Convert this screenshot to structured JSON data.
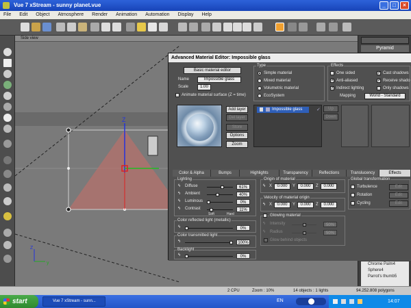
{
  "app": {
    "title": "Vue 7 xStream - sunny planet.vue",
    "win_min": "_",
    "win_max": "□",
    "win_close": "×"
  },
  "menu": [
    "File",
    "Edit",
    "Object",
    "Atmosphere",
    "Render",
    "Animation",
    "Automation",
    "Display",
    "Help"
  ],
  "viewport": {
    "label": "Side view",
    "axis_z": "Z",
    "axis_y": "y"
  },
  "right_panel": {
    "tab": "Pyramid",
    "objects": [
      "Chrome Palm4",
      "Sphere4",
      "Parrot's thumb5"
    ]
  },
  "dialog": {
    "title": "Advanced Material Editor: Impossible glass",
    "basic_editor_button": "Basic material editor",
    "name_label": "Name",
    "name_value": "Impossible glass",
    "scale_label": "Scale",
    "scale_value": "1.00",
    "animate_label": "Animate material surface (Z = time)",
    "buttons": {
      "add_layer": "Add layer",
      "del_layer": "Del layer",
      "store": "Store",
      "options": "Options",
      "zoom": "Zoom",
      "up": "Up",
      "down": "Down"
    },
    "type": {
      "title": "Type",
      "options": [
        "Simple material",
        "Mixed material",
        "Volumetric material",
        "EcoSystem"
      ],
      "selected_index": 0
    },
    "effects": {
      "title": "Effects",
      "left": [
        {
          "label": "One sided",
          "checked": false
        },
        {
          "label": "Anti-aliased",
          "checked": true
        },
        {
          "label": "Indirect lighting",
          "checked": true
        }
      ],
      "right": [
        {
          "label": "Cast shadows",
          "checked": true
        },
        {
          "label": "Receive shado",
          "checked": true
        },
        {
          "label": "Only shadows",
          "checked": false
        }
      ],
      "mapping_label": "Mapping",
      "mapping_value": "World - Standard"
    },
    "layer_name": "Impossible glass",
    "tabs": [
      "Color & Alpha",
      "Bumps",
      "Highlights",
      "Transparency",
      "Reflections",
      "Translucency",
      "Effects"
    ],
    "active_tab": "Effects",
    "lighting": {
      "title": "Lighting",
      "rows": [
        {
          "label": "Diffuse",
          "value": "61%",
          "fraction": 0.61
        },
        {
          "label": "Ambient",
          "value": "40%",
          "fraction": 0.4
        },
        {
          "label": "Luminous",
          "value": "0%",
          "fraction": 0.0
        },
        {
          "label": "Contrast",
          "value": "11%",
          "fraction": 0.11
        }
      ],
      "soft": "Soft",
      "hard": "Hard"
    },
    "color_reflected": {
      "title": "Color reflected light (metallic)",
      "value": "0%"
    },
    "color_transmitted": {
      "title": "Color transmitted light",
      "value": "100%"
    },
    "backlight": {
      "title": "Backlight",
      "value": "0%"
    },
    "origin": {
      "title": "Origin of material",
      "x": "0.000",
      "y": "0.000",
      "z": "0.000"
    },
    "velocity": {
      "title": "Velocity of material origin",
      "x": "0.000",
      "y": "0.000",
      "z": "0.000"
    },
    "glowing": {
      "title": "Glowing material",
      "intensity_label": "Intensity",
      "intensity_value": "50%",
      "radius_label": "Radius",
      "radius_value": "50%",
      "glow_behind": "Glow behind objects"
    },
    "global_transform": {
      "title": "Global transformation",
      "items": [
        "Turbulence",
        "Rotation",
        "Cycling"
      ],
      "edit_label": "Edit"
    }
  },
  "status": {
    "cpu": "2 CPU",
    "zoom": "Zoom : 10%",
    "objects": "14 objects : 1 lights",
    "polygons": "94.252.808 polygons"
  },
  "taskbar": {
    "start": "start",
    "item": "Vue 7 xStream - sunn...",
    "lang": "EN",
    "clock": "14:07"
  },
  "colors": {
    "accent_blue": "#2456c8",
    "start_green": "#2f8a2f",
    "pyramid_fill": "#b5726c"
  }
}
